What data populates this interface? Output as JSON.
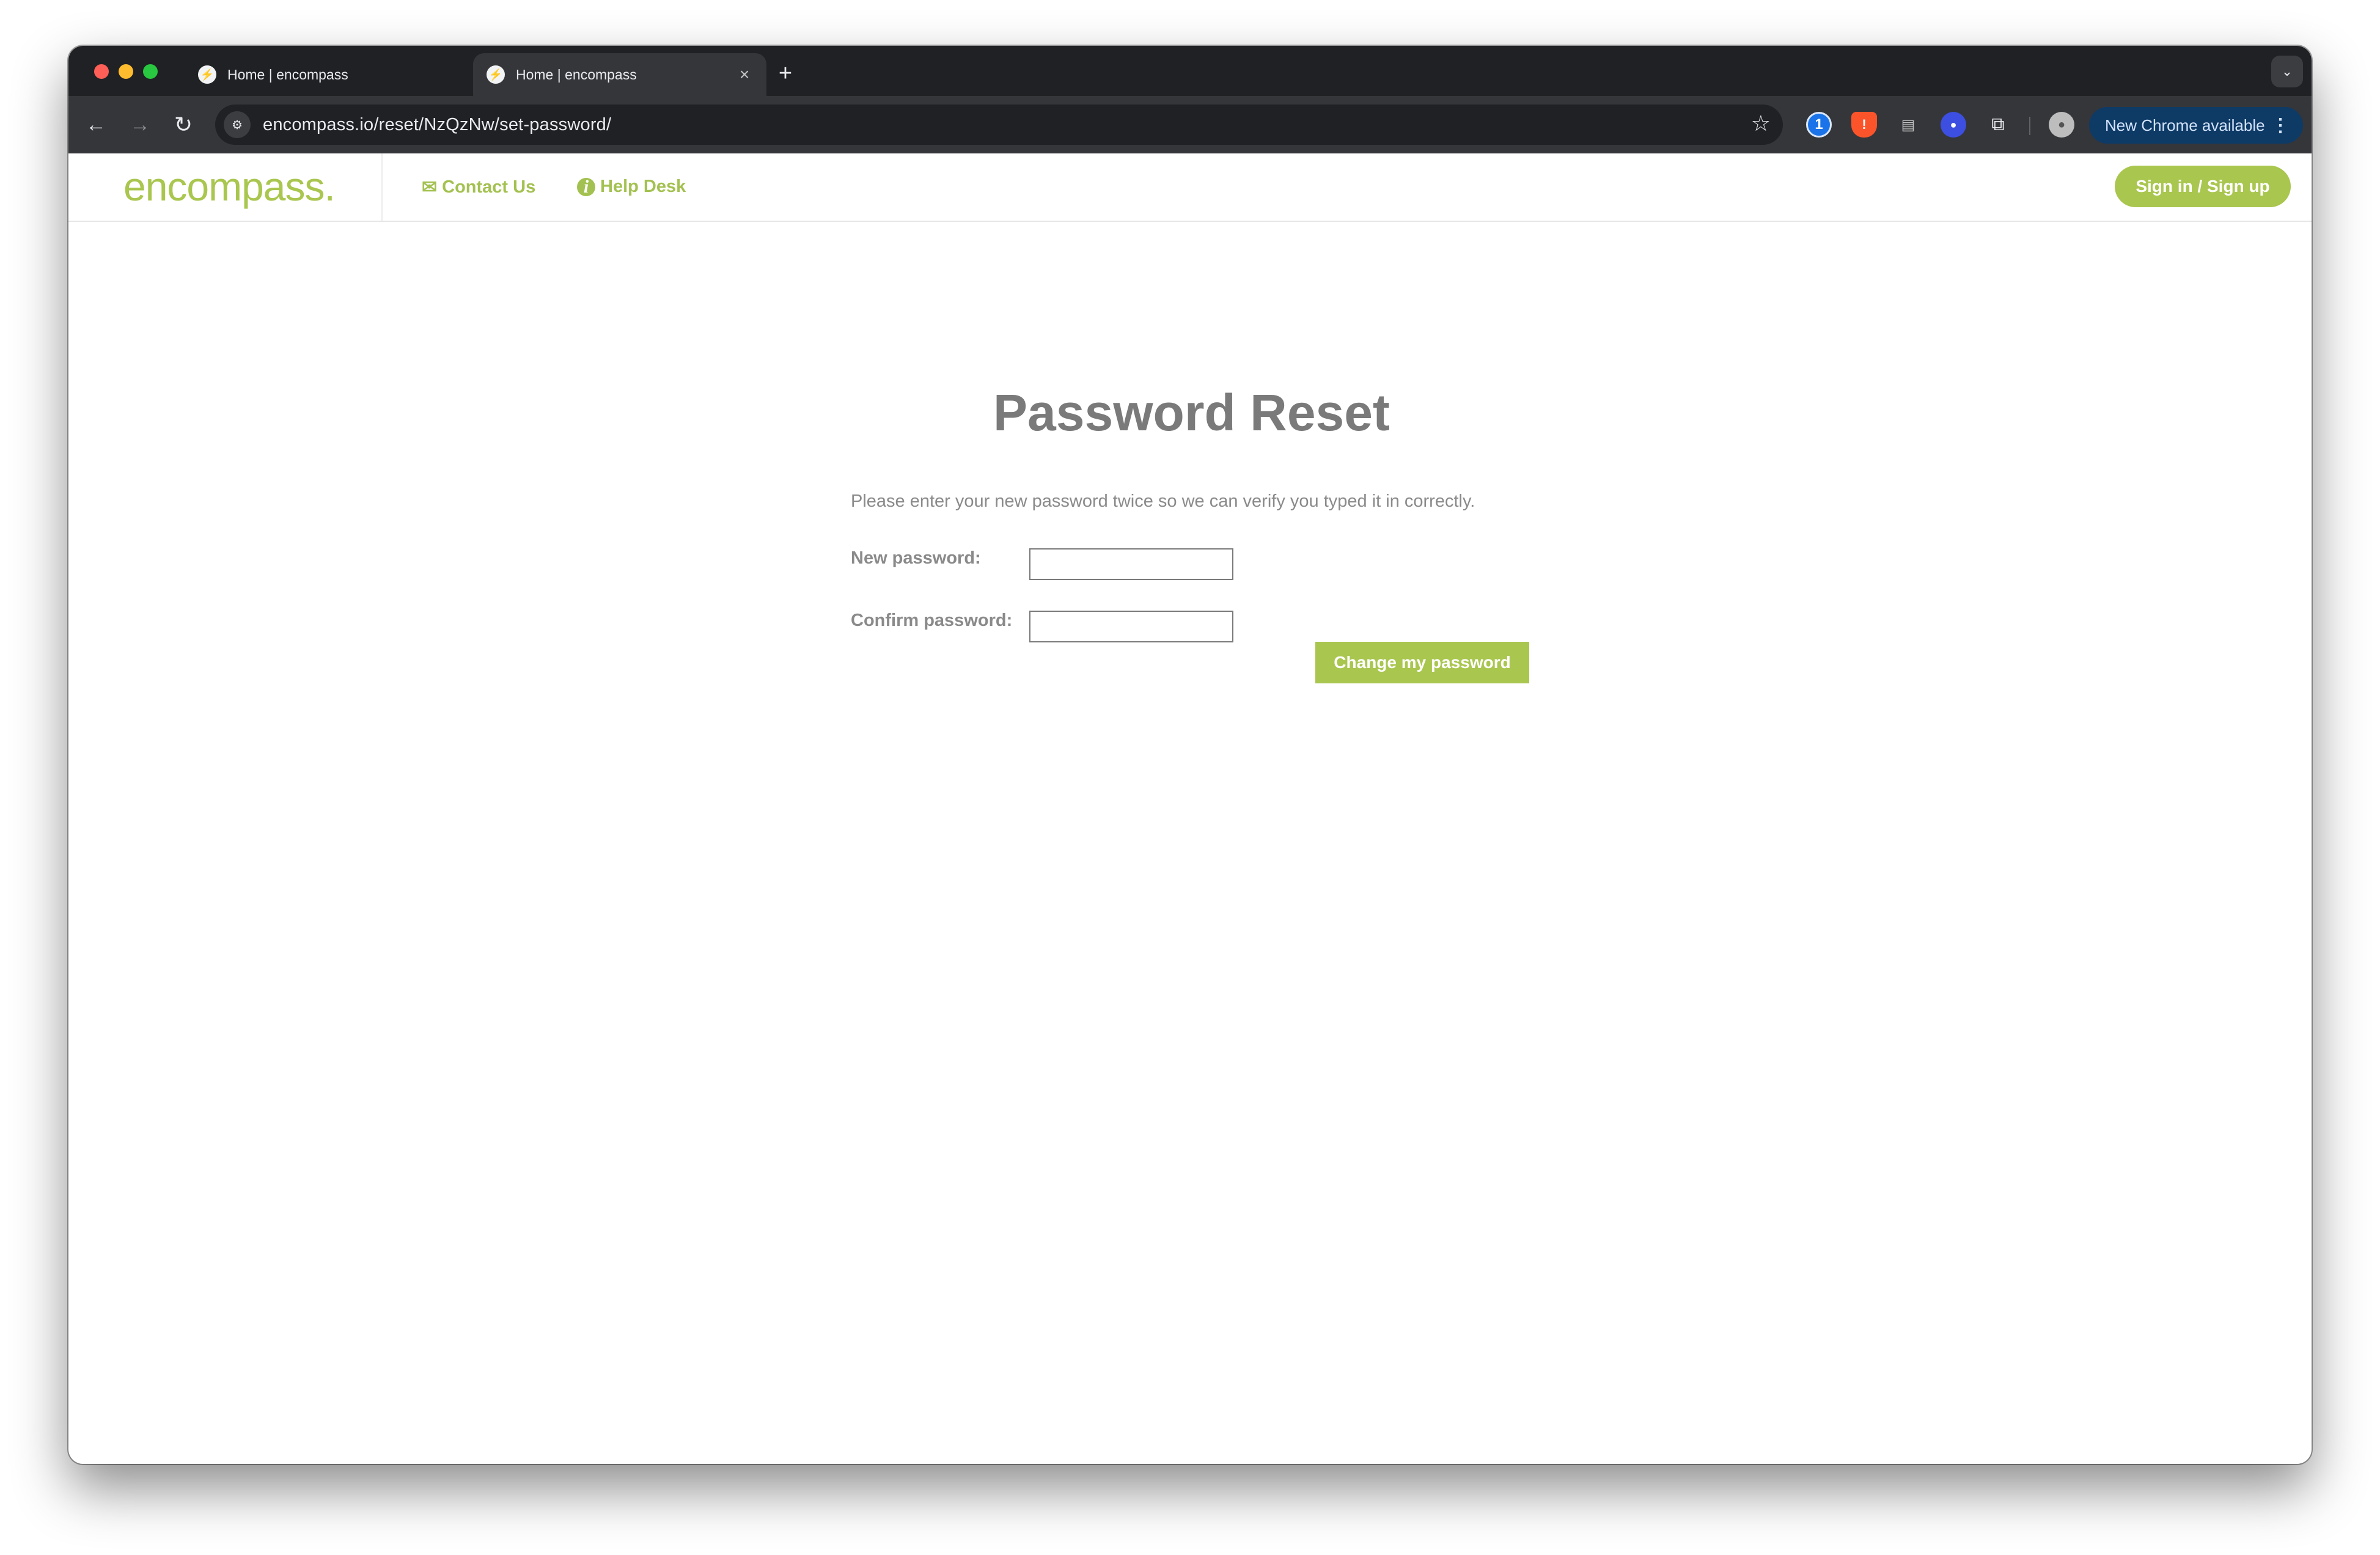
{
  "browser": {
    "tabs": [
      {
        "title": "Home | encompass",
        "active": false
      },
      {
        "title": "Home | encompass",
        "active": true
      }
    ],
    "new_tab_symbol": "+",
    "close_symbol": "×",
    "url": "encompass.io/reset/NzQzNw/set-password/",
    "update_button": "New Chrome available"
  },
  "site": {
    "logo": "encompass.",
    "nav": {
      "contact": "Contact Us",
      "help": "Help Desk"
    },
    "signin": "Sign in / Sign up",
    "accent_color": "#a9c64f"
  },
  "form": {
    "title": "Password Reset",
    "intro": "Please enter your new password twice so we can verify you typed it in correctly.",
    "new_password_label": "New password:",
    "new_password_value": "",
    "confirm_password_label": "Confirm password:",
    "confirm_password_value": "",
    "submit": "Change my password"
  }
}
